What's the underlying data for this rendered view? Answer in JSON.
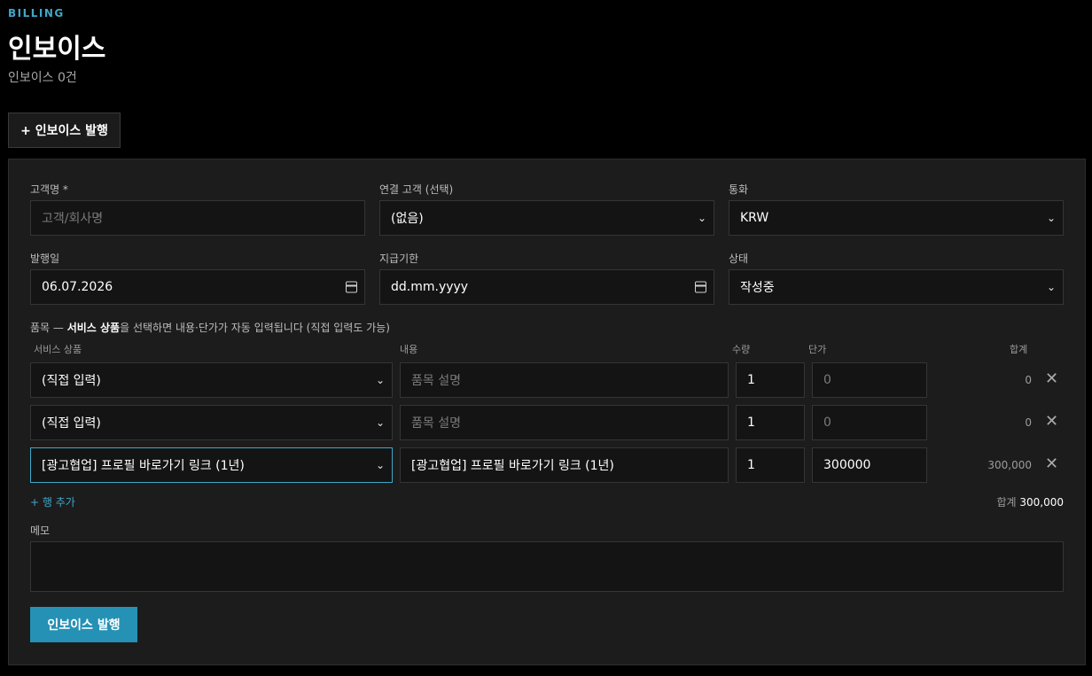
{
  "header": {
    "eyebrow": "BILLING",
    "title": "인보이스",
    "count_text": "인보이스 0건",
    "new_button": "+ 인보이스 발행"
  },
  "form": {
    "customer_name_label": "고객명 *",
    "customer_name_placeholder": "고객/회사명",
    "linked_customer_label": "연결 고객 (선택)",
    "linked_customer_value": "(없음)",
    "currency_label": "통화",
    "currency_value": "KRW",
    "issue_date_label": "발행일",
    "issue_date_value": "06.07.2026",
    "due_date_label": "지급기한",
    "due_date_value": "dd.mm.yyyy",
    "status_label": "상태",
    "status_value": "작성중",
    "items_hint_prefix": "품목 — ",
    "items_hint_bold": "서비스 상품",
    "items_hint_suffix": "을 선택하면 내용·단가가 자동 입력됩니다 (직접 입력도 가능)",
    "columns": {
      "product": "서비스 상품",
      "description": "내용",
      "qty": "수량",
      "price": "단가",
      "total": "합계"
    },
    "description_placeholder": "품목 설명",
    "price_placeholder": "0",
    "rows": [
      {
        "product": "(직접 입력)",
        "description": "",
        "qty": "1",
        "price": "",
        "total": "0"
      },
      {
        "product": "(직접 입력)",
        "description": "",
        "qty": "1",
        "price": "",
        "total": "0"
      },
      {
        "product": "[광고협업] 프로필 바로가기 링크 (1년)",
        "description": "[광고협업] 프로필 바로가기 링크 (1년)",
        "qty": "1",
        "price": "300000",
        "total": "300,000"
      }
    ],
    "add_row": "+ 행 추가",
    "grand_total_label": "합계",
    "grand_total_value": "300,000",
    "memo_label": "메모",
    "submit": "인보이스 발행"
  },
  "colors": {
    "accent": "#3fa7c9",
    "submit_bg": "#2591b5",
    "background": "#000000",
    "panel": "#1c1c1c"
  }
}
